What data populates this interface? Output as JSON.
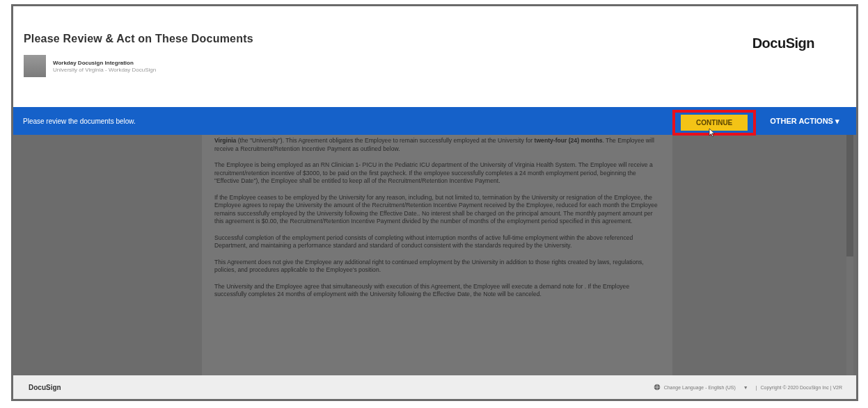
{
  "header": {
    "title": "Please Review & Act on These Documents",
    "logo": "DocuSign",
    "sender": {
      "name": "Workday Docusign Integration",
      "subtitle": "University of Virginia - Workday DocuSign"
    }
  },
  "action_bar": {
    "message": "Please review the documents below.",
    "continue_button": "CONTINUE",
    "other_actions": "OTHER ACTIONS",
    "other_actions_caret": "▾"
  },
  "document": {
    "paragraphs": [
      "**Virginia** (the \"University\").  This Agreement obligates the Employee to remain successfully employed at the University for **twenty-four (24) months**. The Employee will receive a Recruitment/Retention Incentive Payment as outlined below.",
      "The Employee is being employed as an RN Clinician 1- PICU in the Pediatric ICU department of the University of Virginia Health System.  The Employee will receive a recruitment/retention incentive of $3000, to be paid on the first paycheck.  If the employee successfully completes a 24 month employment period, beginning the \"Effective Date\"), the Employee shall be entitled to keep all of the Recruitment/Retention Incentive Payment.",
      "If the Employee ceases to be employed by the University for any reason, including, but not limited to, termination by the University or resignation of the Employee, the Employee agrees to repay the University the amount of the Recruitment/Retention Incentive Payment received by the Employee, reduced for each month the Employee remains successfully employed by the University following the Effective Date..  No interest shall be charged on the principal amount. The monthly payment amount per this agreement is $0.00, the Recruitment/Retention Incentive Payment divided by the number of months of the employment period specified in this agreement.",
      "Successful completion of the employment period consists of completing without interruption months of active full-time employment within the above referenced Department, and maintaining a performance standard and standard of conduct consistent with the standards required by the University.",
      "This Agreement does not give the Employee any additional right to continued employment by the University in addition to those rights created by laws, regulations, policies, and procedures applicable to the Employee's position.",
      "The University and the Employee agree that simultaneously with execution of this Agreement, the Employee will execute a demand note for .  If the Employee successfully completes 24 months of employment with the University following the Effective Date, the Note will be canceled."
    ]
  },
  "footer": {
    "logo": "DocuSign",
    "language": "Change Language - English (US)",
    "language_caret": "▼",
    "separator": "|",
    "copyright": "Copyright © 2020 DocuSign Inc | V2R"
  }
}
